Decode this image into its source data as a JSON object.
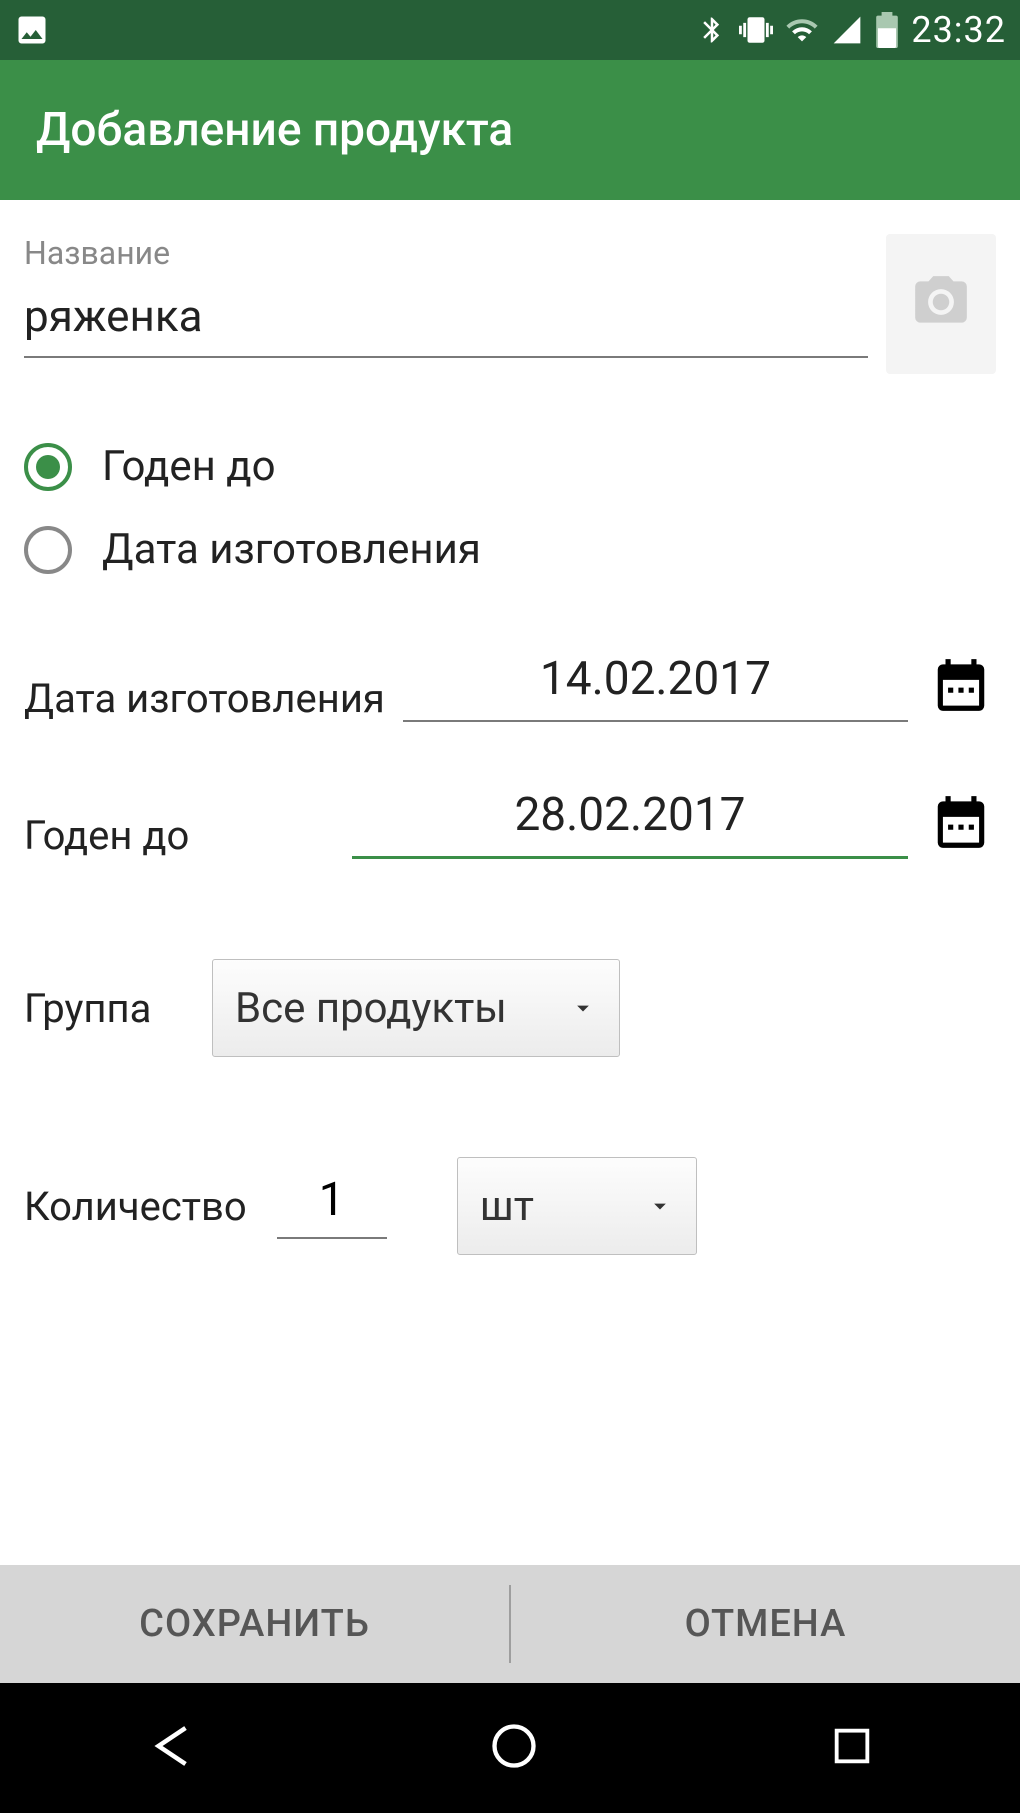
{
  "status": {
    "time": "23:32"
  },
  "app": {
    "title": "Добавление продукта"
  },
  "form": {
    "name_label": "Название",
    "name_value": "ряженка",
    "radio": {
      "opt1": "Годен до",
      "opt2": "Дата изготовления",
      "selected": "opt1"
    },
    "date_mfg": {
      "label": "Дата изготовления",
      "value": "14.02.2017"
    },
    "date_exp": {
      "label": "Годен до",
      "value": "28.02.2017"
    },
    "group": {
      "label": "Группа",
      "value": "Все продукты"
    },
    "qty": {
      "label": "Количество",
      "value": "1",
      "unit": "шт"
    }
  },
  "actions": {
    "save": "СОХРАНИТЬ",
    "cancel": "ОТМЕНА"
  }
}
